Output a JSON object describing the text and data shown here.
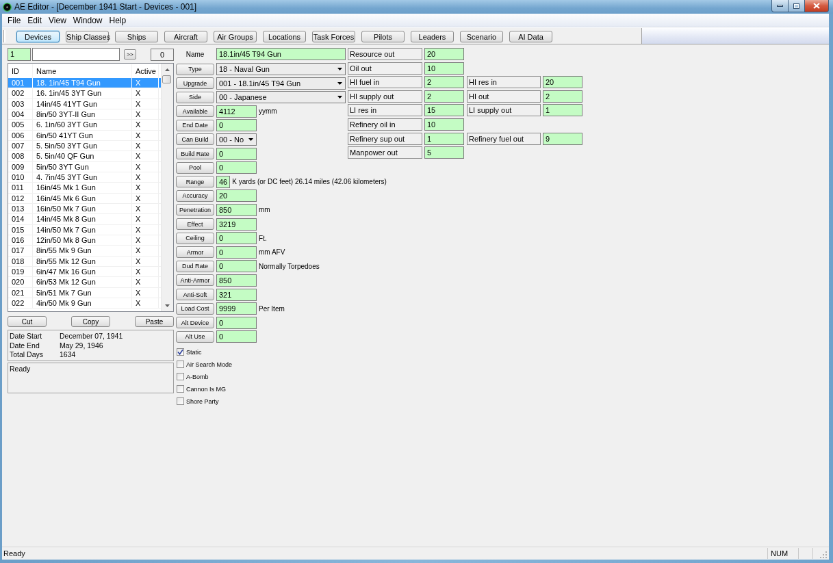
{
  "window": {
    "title": "AE Editor - [December 1941 Start - Devices - 001]"
  },
  "menu": [
    {
      "label": "File"
    },
    {
      "label": "Edit"
    },
    {
      "label": "View"
    },
    {
      "label": "Window"
    },
    {
      "label": "Help"
    }
  ],
  "toolbar": {
    "tabs": [
      {
        "label": "Devices",
        "selected": true
      },
      {
        "label": "Ship Classes",
        "selected": false
      },
      {
        "label": "Ships",
        "selected": false
      },
      {
        "label": "Aircraft",
        "selected": false
      },
      {
        "label": "Air Groups",
        "selected": false
      },
      {
        "label": "Locations",
        "selected": false
      },
      {
        "label": "Task Forces",
        "selected": false
      },
      {
        "label": "Pilots",
        "selected": false
      },
      {
        "label": "Leaders",
        "selected": false
      },
      {
        "label": "Scenario",
        "selected": false
      },
      {
        "label": "AI Data",
        "selected": false
      }
    ]
  },
  "record_nav": {
    "record": "1",
    "go_button": ">>",
    "count": "0"
  },
  "device_list": {
    "columns": [
      "ID",
      "Name",
      "Active"
    ],
    "rows": [
      {
        "id": "001",
        "name": "18. 1in/45 T94 Gun",
        "active": "X",
        "selected": true
      },
      {
        "id": "002",
        "name": "16. 1in/45 3YT Gun",
        "active": "X",
        "selected": false
      },
      {
        "id": "003",
        "name": "14in/45 41YT Gun",
        "active": "X",
        "selected": false
      },
      {
        "id": "004",
        "name": "8in/50 3YT-II Gun",
        "active": "X",
        "selected": false
      },
      {
        "id": "005",
        "name": "6. 1in/60 3YT Gun",
        "active": "X",
        "selected": false
      },
      {
        "id": "006",
        "name": "6in/50 41YT Gun",
        "active": "X",
        "selected": false
      },
      {
        "id": "007",
        "name": "5. 5in/50 3YT Gun",
        "active": "X",
        "selected": false
      },
      {
        "id": "008",
        "name": "5. 5in/40 QF Gun",
        "active": "X",
        "selected": false
      },
      {
        "id": "009",
        "name": "5in/50 3YT Gun",
        "active": "X",
        "selected": false
      },
      {
        "id": "010",
        "name": "4. 7in/45 3YT Gun",
        "active": "X",
        "selected": false
      },
      {
        "id": "011",
        "name": "16in/45 Mk 1 Gun",
        "active": "X",
        "selected": false
      },
      {
        "id": "012",
        "name": "16in/45 Mk 6 Gun",
        "active": "X",
        "selected": false
      },
      {
        "id": "013",
        "name": "16in/50 Mk 7 Gun",
        "active": "X",
        "selected": false
      },
      {
        "id": "014",
        "name": "14in/45 Mk 8 Gun",
        "active": "X",
        "selected": false
      },
      {
        "id": "015",
        "name": "14in/50 Mk 7 Gun",
        "active": "X",
        "selected": false
      },
      {
        "id": "016",
        "name": "12in/50 Mk 8 Gun",
        "active": "X",
        "selected": false
      },
      {
        "id": "017",
        "name": "8in/55 Mk 9 Gun",
        "active": "X",
        "selected": false
      },
      {
        "id": "018",
        "name": "8in/55 Mk 12 Gun",
        "active": "X",
        "selected": false
      },
      {
        "id": "019",
        "name": "6in/47 Mk 16 Gun",
        "active": "X",
        "selected": false
      },
      {
        "id": "020",
        "name": "6in/53 Mk 12 Gun",
        "active": "X",
        "selected": false
      },
      {
        "id": "021",
        "name": "5in/51 Mk 7 Gun",
        "active": "X",
        "selected": false
      },
      {
        "id": "022",
        "name": "4in/50 Mk 9 Gun",
        "active": "X",
        "selected": false
      }
    ]
  },
  "edit_buttons": [
    "Cut",
    "Copy",
    "Paste"
  ],
  "scenario_info": [
    {
      "label": "Date Start",
      "value": "December 07, 1941"
    },
    {
      "label": "Date End",
      "value": "May 29, 1946"
    },
    {
      "label": "Total Days",
      "value": "1634"
    }
  ],
  "message_panel": {
    "text": "Ready"
  },
  "form": {
    "name": {
      "label": "Name",
      "value": "18.1in/45 T94 Gun"
    },
    "fields": [
      {
        "label": "Type",
        "kind": "wide_dropdown",
        "value": "18 - Naval Gun"
      },
      {
        "label": "Upgrade",
        "kind": "wide_dropdown",
        "value": "001 - 18.1in/45 T94 Gun"
      },
      {
        "label": "Side",
        "kind": "wide_dropdown",
        "value": "00 - Japanese"
      },
      {
        "label": "Available",
        "kind": "input",
        "value": "4112",
        "unit": "yymm"
      },
      {
        "label": "End Date",
        "kind": "input",
        "value": "0"
      },
      {
        "label": "Can Build",
        "kind": "dropdown",
        "value": "00 - No"
      },
      {
        "label": "Build Rate",
        "kind": "input",
        "value": "0"
      },
      {
        "label": "Pool",
        "kind": "input",
        "value": "0"
      },
      {
        "label": "Range",
        "kind": "input",
        "value": "46",
        "unit": "K yards (or DC feet) 26.14 miles (42.06 kilometers)"
      },
      {
        "label": "Accuracy",
        "kind": "input",
        "value": "20"
      },
      {
        "label": "Penetration",
        "kind": "input",
        "value": "850",
        "unit": "mm"
      },
      {
        "label": "Effect",
        "kind": "input",
        "value": "3219"
      },
      {
        "label": "Ceiling",
        "kind": "input",
        "value": "0",
        "unit": "Ft."
      },
      {
        "label": "Armor",
        "kind": "input",
        "value": "0",
        "unit": "mm AFV"
      },
      {
        "label": "Dud Rate",
        "kind": "input",
        "value": "0",
        "unit": "Normally Torpedoes"
      },
      {
        "label": "Anti-Armor",
        "kind": "input",
        "value": "850"
      },
      {
        "label": "Anti-Soft",
        "kind": "input",
        "value": "321"
      },
      {
        "label": "Load Cost",
        "kind": "input",
        "value": "9999",
        "unit": "Per Item"
      },
      {
        "label": "Alt Device",
        "kind": "input",
        "value": "0"
      },
      {
        "label": "Alt Use",
        "kind": "input",
        "value": "0"
      }
    ],
    "flags": [
      {
        "label": "Static",
        "checked": true
      },
      {
        "label": "Air Search Mode",
        "checked": false
      },
      {
        "label": "A-Bomb",
        "checked": false
      },
      {
        "label": "Cannon Is MG",
        "checked": false
      },
      {
        "label": "Shore Party",
        "checked": false
      }
    ]
  },
  "resources": {
    "rows": [
      {
        "cells": [
          {
            "label": "Resource out",
            "value": "20"
          }
        ]
      },
      {
        "cells": [
          {
            "label": "Oil out",
            "value": "10"
          }
        ]
      },
      {
        "cells": [
          {
            "label": "HI fuel in",
            "value": "2"
          },
          {
            "label": "HI res in",
            "value": "20"
          }
        ]
      },
      {
        "cells": [
          {
            "label": "HI supply out",
            "value": "2"
          },
          {
            "label": "HI out",
            "value": "2"
          }
        ]
      },
      {
        "cells": [
          {
            "label": "LI res in",
            "value": "15"
          },
          {
            "label": "LI supply out",
            "value": "1"
          }
        ]
      },
      {
        "cells": [
          {
            "label": "Refinery oil in",
            "value": "10"
          }
        ]
      },
      {
        "cells": [
          {
            "label": "Refinery sup out",
            "value": "1"
          },
          {
            "label": "Refinery fuel out",
            "value": "9"
          }
        ]
      },
      {
        "cells": [
          {
            "label": "Manpower out",
            "value": "5"
          }
        ]
      }
    ]
  },
  "status_bar": {
    "text": "Ready",
    "indicators": [
      "NUM"
    ]
  }
}
